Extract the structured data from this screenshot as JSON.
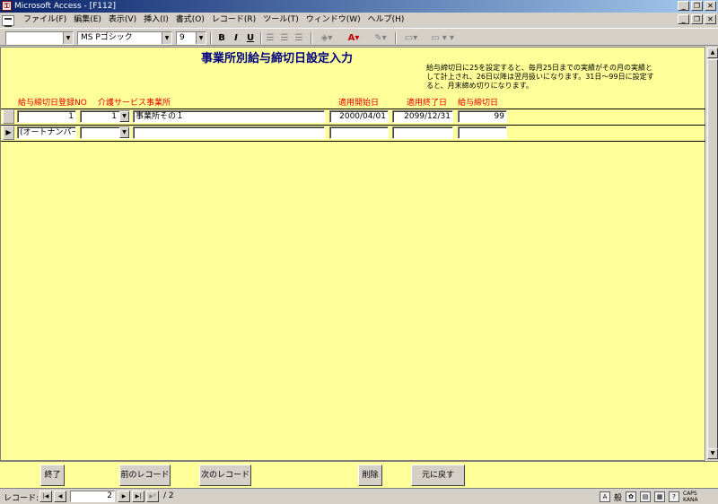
{
  "window": {
    "title": "Microsoft Access - [F112]"
  },
  "menu": [
    "ファイル(F)",
    "編集(E)",
    "表示(V)",
    "挿入(I)",
    "書式(O)",
    "レコード(R)",
    "ツール(T)",
    "ウィンドウ(W)",
    "ヘルプ(H)"
  ],
  "toolbar": {
    "object_combo": "",
    "font_name": "MS Pゴシック",
    "font_size": "9",
    "bold": "B",
    "italic": "I",
    "underline": "U"
  },
  "form": {
    "title": "事業所別給与締切日設定入力",
    "note": "給与締切日に25を設定すると、毎月25日までの実績がその月の実績として計上され、26日以降は翌月扱いになります。31日～99日に設定すると、月末締め切りになります。",
    "headers": {
      "reg_no": "給与締切日登録NO",
      "service": "介護サービス事業所",
      "start_date": "適用開始日",
      "end_date": "適用終了日",
      "cutoff_day": "給与締切日"
    },
    "rows": [
      {
        "reg_no": "1",
        "service_code": "1",
        "service_name": "事業所その１",
        "start_date": "2000/04/01",
        "end_date": "2099/12/31",
        "cutoff_day": "99"
      },
      {
        "reg_no": "(オートナンバー)",
        "service_code": "",
        "service_name": "",
        "start_date": "",
        "end_date": "",
        "cutoff_day": ""
      }
    ]
  },
  "footer": {
    "close": "終了",
    "prev": "前のレコード",
    "next": "次のレコード",
    "delete": "削除",
    "undo": "元に戻す"
  },
  "navigation": {
    "label": "レコード:",
    "current": "2",
    "total": "/ 2"
  },
  "tray": {
    "ime": "般",
    "caps": "CAPS KANA"
  }
}
